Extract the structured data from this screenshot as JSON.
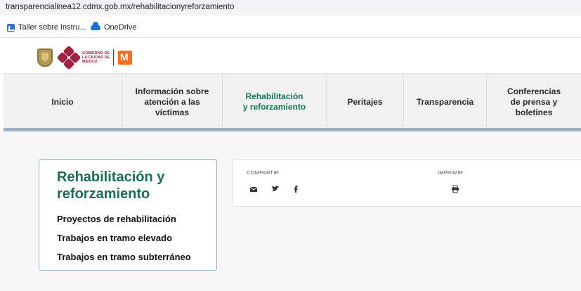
{
  "browser": {
    "url": "transparencialinea12.cdmx.gob.mx/rehabilitacionyreforzamiento",
    "bookmarks": [
      {
        "label": "Taller sobre Instru...",
        "icon": "document-icon"
      },
      {
        "label": "OneDrive",
        "icon": "cloud-icon"
      }
    ]
  },
  "header": {
    "logo_text": "GOBIERNO DE LA CIUDAD DE MÉXICO"
  },
  "nav": {
    "items": [
      {
        "label": "Inicio",
        "active": false
      },
      {
        "label": "Información sobre atención a las víctimas",
        "active": false
      },
      {
        "label": "Rehabilitación y reforzamiento",
        "active": true
      },
      {
        "label": "Peritajes",
        "active": false
      },
      {
        "label": "Transparencia",
        "active": false
      },
      {
        "label": "Conferencias de prensa y boletines",
        "active": false
      }
    ],
    "active_color": "#14735a"
  },
  "sidebar": {
    "title": "Rehabilitación y reforzamiento",
    "links": [
      "Proyectos de rehabilitación",
      "Trabajos en tramo elevado",
      "Trabajos en tramo subterráneo"
    ]
  },
  "share": {
    "compartir_label": "COMPARTIR",
    "imprimir_label": "IMPRIMIR",
    "icons": [
      "mail-icon",
      "twitter-icon",
      "facebook-icon",
      "print-icon"
    ]
  }
}
